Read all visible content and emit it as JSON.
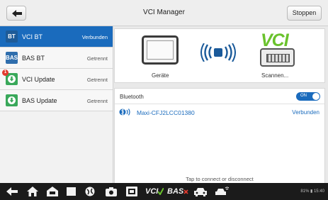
{
  "header": {
    "title": "VCI Manager",
    "stop_label": "Stoppen"
  },
  "sidebar": {
    "items": [
      {
        "icon_text": "BT",
        "icon": "bt-icon",
        "label": "VCI BT",
        "status": "Verbunden",
        "active": true
      },
      {
        "icon_text": "BAS",
        "icon": "bas-icon",
        "label": "BAS BT",
        "status": "Getrennt",
        "active": false
      },
      {
        "icon_text": "",
        "icon": "download-icon",
        "label": "VCI Update",
        "status": "Getrennt",
        "badge": "1",
        "active": false
      },
      {
        "icon_text": "",
        "icon": "download-icon",
        "label": "BAS Update",
        "status": "Getrennt",
        "active": false
      }
    ]
  },
  "devices": {
    "device_label": "Geräte",
    "brand": "VCI",
    "scan_label": "Scannen..."
  },
  "bluetooth": {
    "title": "Bluetooth",
    "toggle_label": "ON",
    "device_name": "Maxi-CFJ2LCC01380",
    "device_status": "Verbunden",
    "hint": "Tap to connect or disconnect"
  },
  "navbar": {
    "vci_label": "VCI",
    "bas_label": "BAS",
    "status_text": "81% ▮ 15:40"
  },
  "colors": {
    "accent": "#1a6bbd",
    "vci_green": "#6ac22c",
    "update_green": "#39a85a",
    "badge_red": "#e23b2f"
  }
}
